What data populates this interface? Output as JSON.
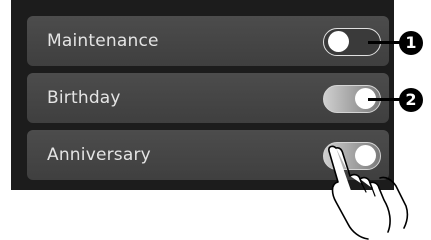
{
  "settings": {
    "items": [
      {
        "label": "Maintenance",
        "toggle_state": "off"
      },
      {
        "label": "Birthday",
        "toggle_state": "on"
      },
      {
        "label": "Anniversary",
        "toggle_state": "on"
      }
    ]
  },
  "callouts": {
    "one": "1",
    "two": "2"
  },
  "icons": {
    "pointer": "hand-pointer-icon"
  },
  "colors": {
    "screen_background": "#1c1c1c",
    "row_background": "#474747",
    "label_text": "#e4e4e4",
    "toggle_on": "#cfcfcf",
    "toggle_off": "#3a3a3a",
    "callout": "#000000"
  }
}
